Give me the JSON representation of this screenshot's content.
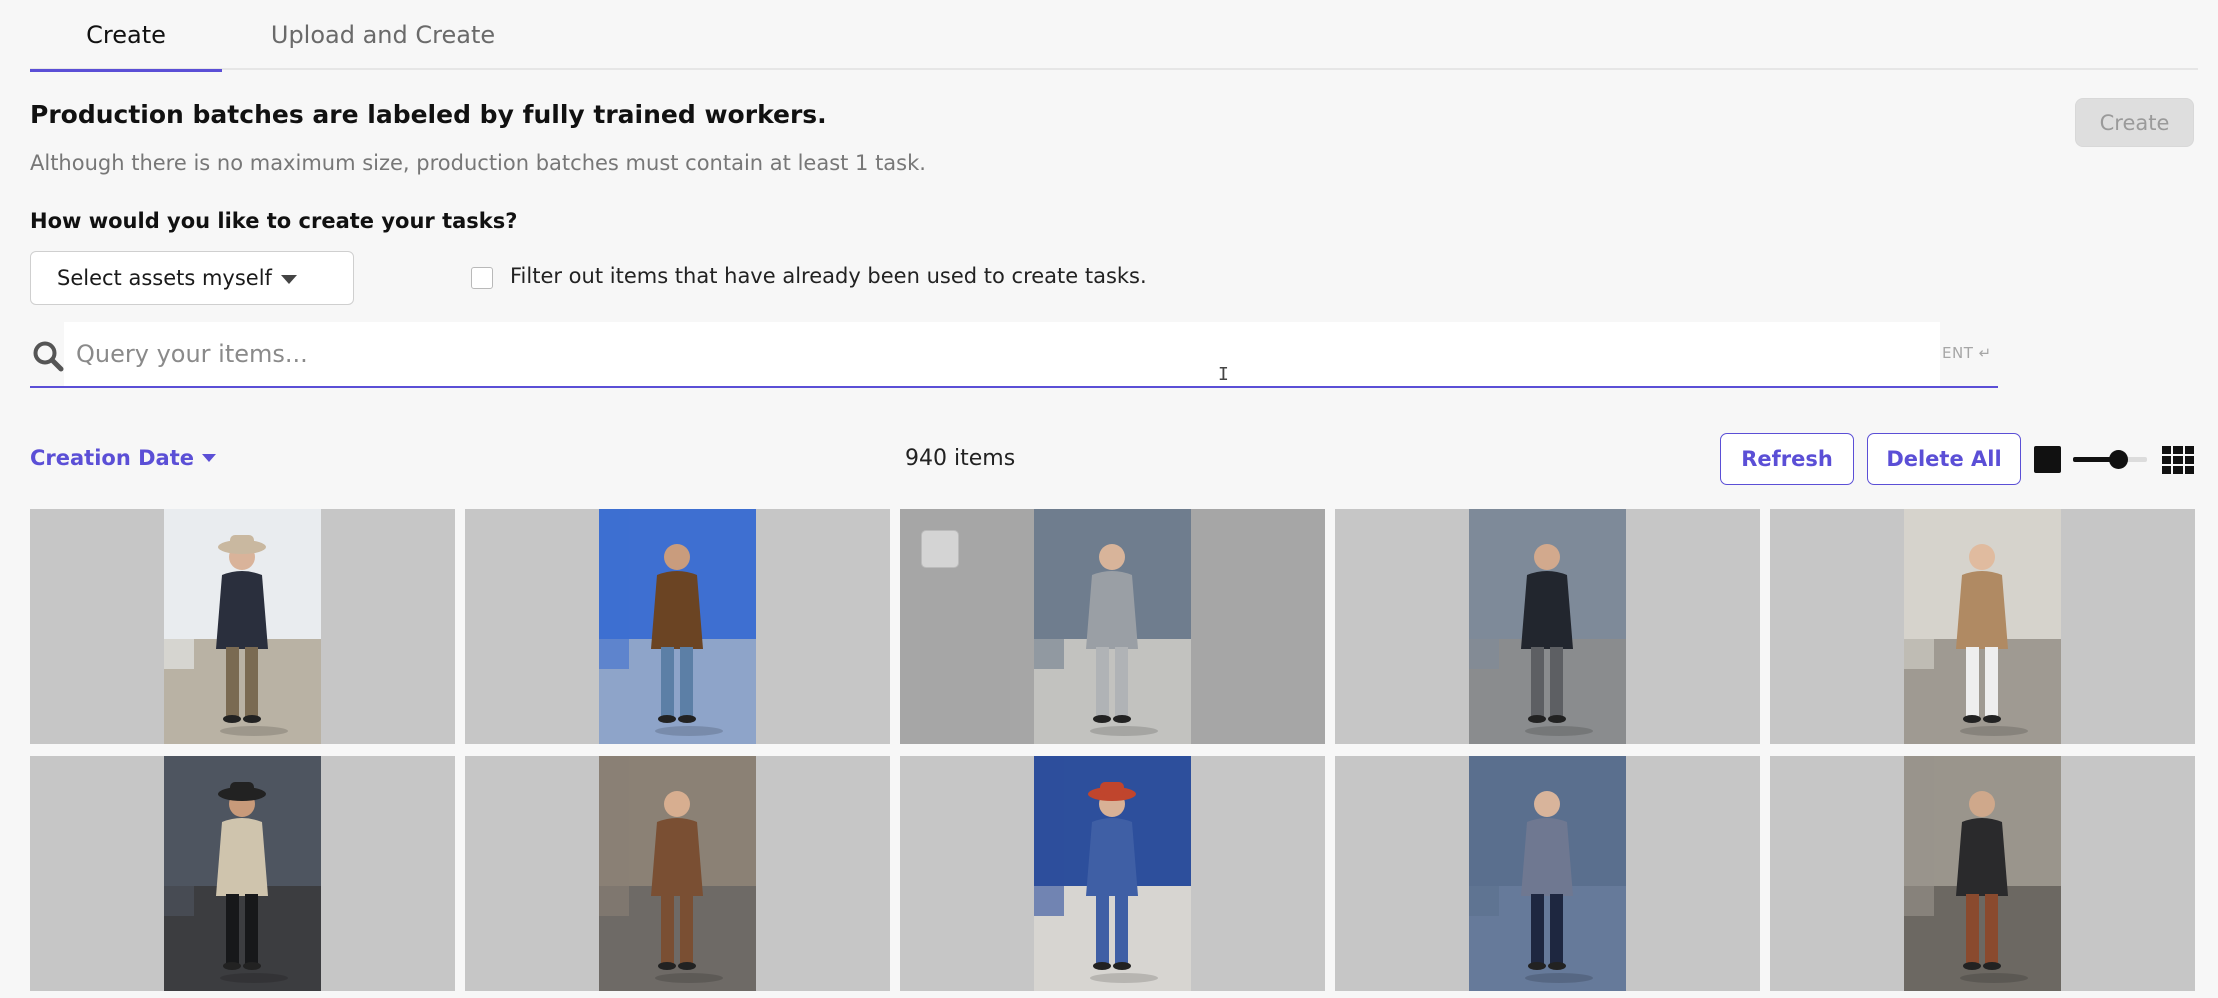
{
  "tabs": [
    {
      "label": "Create",
      "active": true
    },
    {
      "label": "Upload and Create",
      "active": false
    }
  ],
  "header": {
    "title": "Production batches are labeled by fully trained workers.",
    "subtitle": "Although there is no maximum size, production batches must contain at least 1 task.",
    "create_button": "Create"
  },
  "task_creation": {
    "question": "How would you like to create your tasks?",
    "method_selected": "Select assets myself",
    "filter_label": "Filter out items that have already been used to create tasks.",
    "filter_checked": false
  },
  "query": {
    "placeholder": "Query your items...",
    "value": "",
    "enter_hint": "ENT ↵"
  },
  "toolbar": {
    "sort_label": "Creation Date",
    "item_count": "940 items",
    "refresh_label": "Refresh",
    "delete_all_label": "Delete All",
    "thumbnail_size_level": 0.65
  },
  "colors": {
    "accent": "#5b4fd6",
    "tile_background": "#c6c6c6",
    "disabled_button": "#dedede"
  },
  "items": [
    {
      "sky": "#e9ecef",
      "ground": "#b9b2a4",
      "coat": "#2a2f3d",
      "skin": "#d9b39a",
      "legs": "#7a6a52",
      "hat": "#c9b8a0"
    },
    {
      "sky": "#3e6fd1",
      "ground": "#8ea4c9",
      "coat": "#6b4423",
      "skin": "#c99c7d",
      "legs": "#5c7fa6",
      "hat": ""
    },
    {
      "sky": "#6f7d8e",
      "ground": "#c2c2bf",
      "coat": "#9a9fa5",
      "skin": "#d8b49a",
      "legs": "#b0b3b6",
      "hat": ""
    },
    {
      "sky": "#7e8a99",
      "ground": "#8a8c8e",
      "coat": "#22262e",
      "skin": "#d2a98d",
      "legs": "#5d5f63",
      "hat": ""
    },
    {
      "sky": "#d6d3cc",
      "ground": "#9f9a92",
      "coat": "#b08a63",
      "skin": "#e0bb9f",
      "legs": "#eeeeee",
      "hat": ""
    },
    {
      "sky": "#4e5560",
      "ground": "#3c3d40",
      "coat": "#cfc4ad",
      "skin": "#c89a7a",
      "legs": "#17181a",
      "hat": "#222"
    },
    {
      "sky": "#8b8175",
      "ground": "#6e6a66",
      "coat": "#7a4f33",
      "skin": "#d7ae90",
      "legs": "#7a4f33",
      "hat": ""
    },
    {
      "sky": "#2d4f9c",
      "ground": "#d7d5d1",
      "coat": "#3f5fa5",
      "skin": "#d8b196",
      "legs": "#3f5fa5",
      "hat": "#c0452d"
    },
    {
      "sky": "#5a6f8e",
      "ground": "#667a9a",
      "coat": "#6f7891",
      "skin": "#d8b49b",
      "legs": "#1e2740",
      "hat": ""
    },
    {
      "sky": "#9a958c",
      "ground": "#6c6862",
      "coat": "#2a2a2c",
      "skin": "#cfa88b",
      "legs": "#8a4a2e",
      "hat": ""
    }
  ]
}
